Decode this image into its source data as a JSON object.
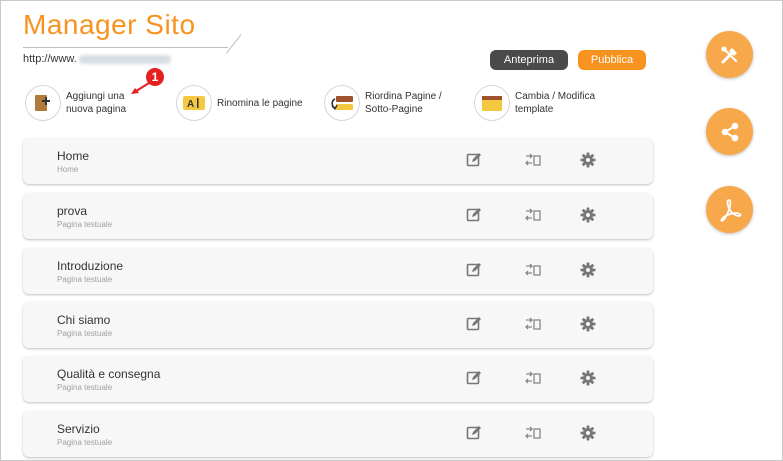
{
  "header": {
    "title": "Manager Sito",
    "url_prefix": "http://www.",
    "preview_label": "Anteprima",
    "publish_label": "Pubblica"
  },
  "toolbar": {
    "add_page": [
      "Aggiungi una",
      "nuova pagina"
    ],
    "rename_pages": "Rinomina le pagine",
    "reorder_pages": [
      "Riordina Pagine /",
      "Sotto-Pagine"
    ],
    "change_template": [
      "Cambia / Modifica",
      "template"
    ]
  },
  "annotation": {
    "badge": "1"
  },
  "pages": [
    {
      "name": "Home",
      "type": "Home"
    },
    {
      "name": "prova",
      "type": "Pagina testuale"
    },
    {
      "name": "Introduzione",
      "type": "Pagina testuale"
    },
    {
      "name": "Chi siamo",
      "type": "Pagina testuale"
    },
    {
      "name": "Qualità e consegna",
      "type": "Pagina testuale"
    },
    {
      "name": "Servizio",
      "type": "Pagina testuale"
    }
  ],
  "colors": {
    "accent": "#f7931e",
    "dark_button": "#4a4a4a",
    "fab": "#f7a84a",
    "badge": "#e52020"
  },
  "icons": {
    "row": [
      "edit-icon",
      "move-page-icon",
      "gear-icon"
    ],
    "fabs": [
      "tools-icon",
      "share-icon",
      "pdf-icon"
    ]
  }
}
